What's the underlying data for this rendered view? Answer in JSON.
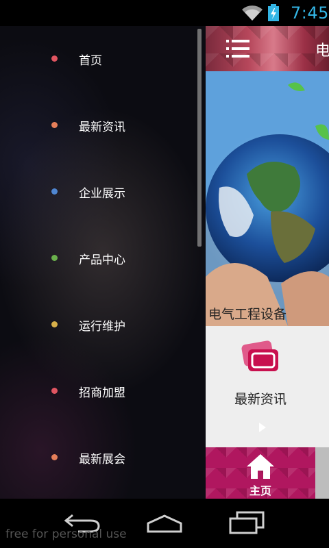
{
  "status_bar": {
    "time": "7:45",
    "icons": [
      "wifi-icon",
      "battery-charging-icon"
    ],
    "accent_color": "#33b5e5"
  },
  "drawer": {
    "items": [
      {
        "label": "首页",
        "dot_color": "#e05561"
      },
      {
        "label": "最新资讯",
        "dot_color": "#e57f5a"
      },
      {
        "label": "企业展示",
        "dot_color": "#4f86d1"
      },
      {
        "label": "产品中心",
        "dot_color": "#6ab04c"
      },
      {
        "label": "运行维护",
        "dot_color": "#d8b04a"
      },
      {
        "label": "招商加盟",
        "dot_color": "#e05561"
      },
      {
        "label": "最新展会",
        "dot_color": "#e57f5a"
      }
    ]
  },
  "content": {
    "header": {
      "title": "电",
      "menu_icon": "menu-icon"
    },
    "banner": {
      "caption": "电气工程设备"
    },
    "card": {
      "label": "最新资讯",
      "icon": "cards-icon"
    },
    "bottom_tab": {
      "label": "主页",
      "icon": "home-icon",
      "color": "#b0175f"
    }
  },
  "nav_bar": {
    "buttons": [
      "back-icon",
      "home-icon",
      "recent-apps-icon"
    ],
    "watermark": "free for personal use"
  }
}
